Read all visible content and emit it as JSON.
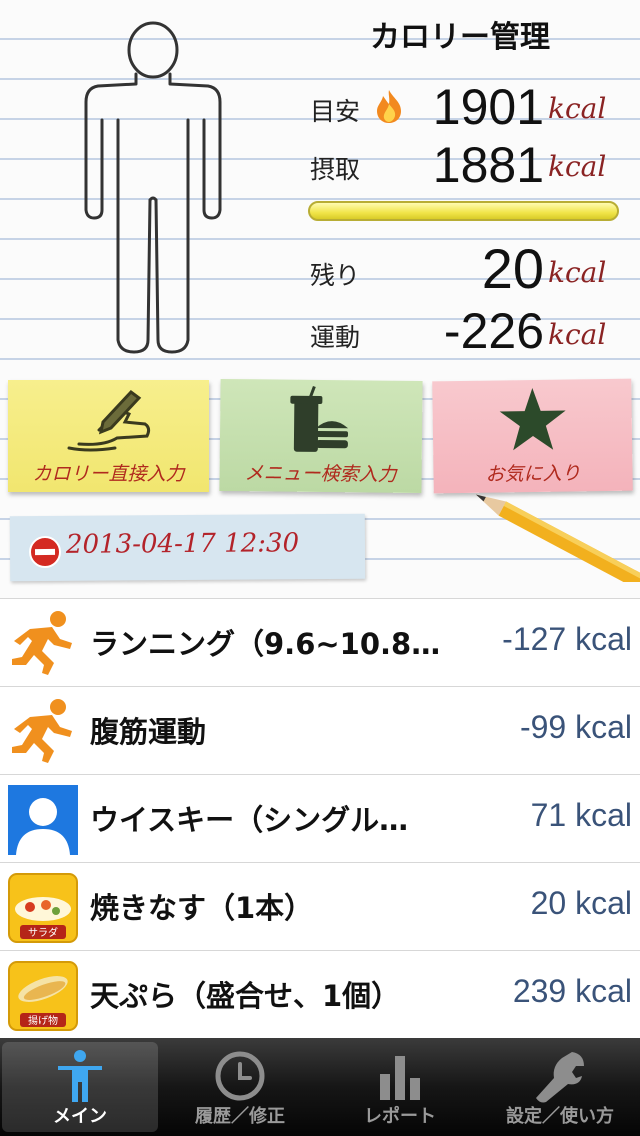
{
  "header": {
    "title": "カロリー管理",
    "stats": {
      "target_label": "目安",
      "target_value": "1901",
      "intake_label": "摂取",
      "intake_value": "1881",
      "remaining_label": "残り",
      "remaining_value": "20",
      "exercise_label": "運動",
      "exercise_value": "-226",
      "unit": "kcal"
    },
    "progress_fraction": 0.99
  },
  "notes": [
    {
      "label": "カロリー直接入力",
      "icon": "pencil-hand-icon"
    },
    {
      "label": "メニュー検索入力",
      "icon": "fast-food-icon"
    },
    {
      "label": "お気に入り",
      "icon": "star-icon"
    }
  ],
  "date": "2013-04-17 12:30",
  "entries": [
    {
      "name": "ランニング（9.6~10.8…",
      "calories": "-127 kcal",
      "icon": "runner-icon"
    },
    {
      "name": "腹筋運動",
      "calories": "-99 kcal",
      "icon": "runner-icon"
    },
    {
      "name": "ウイスキー（シングル…",
      "calories": "71 kcal",
      "icon": "person-placeholder-icon"
    },
    {
      "name": "焼きなす（1本）",
      "calories": "20 kcal",
      "icon": "salad-icon",
      "icon_caption": "サラダ"
    },
    {
      "name": "天ぷら（盛合せ、1個）",
      "calories": "239 kcal",
      "icon": "fried-food-icon",
      "icon_caption": "揚げ物"
    }
  ],
  "tabs": [
    {
      "label": "メイン",
      "icon": "person-icon",
      "active": true
    },
    {
      "label": "履歴／修正",
      "icon": "clock-icon",
      "active": false
    },
    {
      "label": "レポート",
      "icon": "bar-chart-icon",
      "active": false
    },
    {
      "label": "設定／使い方",
      "icon": "wrench-icon",
      "active": false
    }
  ],
  "colors": {
    "unit": "#8a2323",
    "note_label": "#b02a1e",
    "calorie_text": "#3a5379",
    "runner": "#f0901e"
  }
}
